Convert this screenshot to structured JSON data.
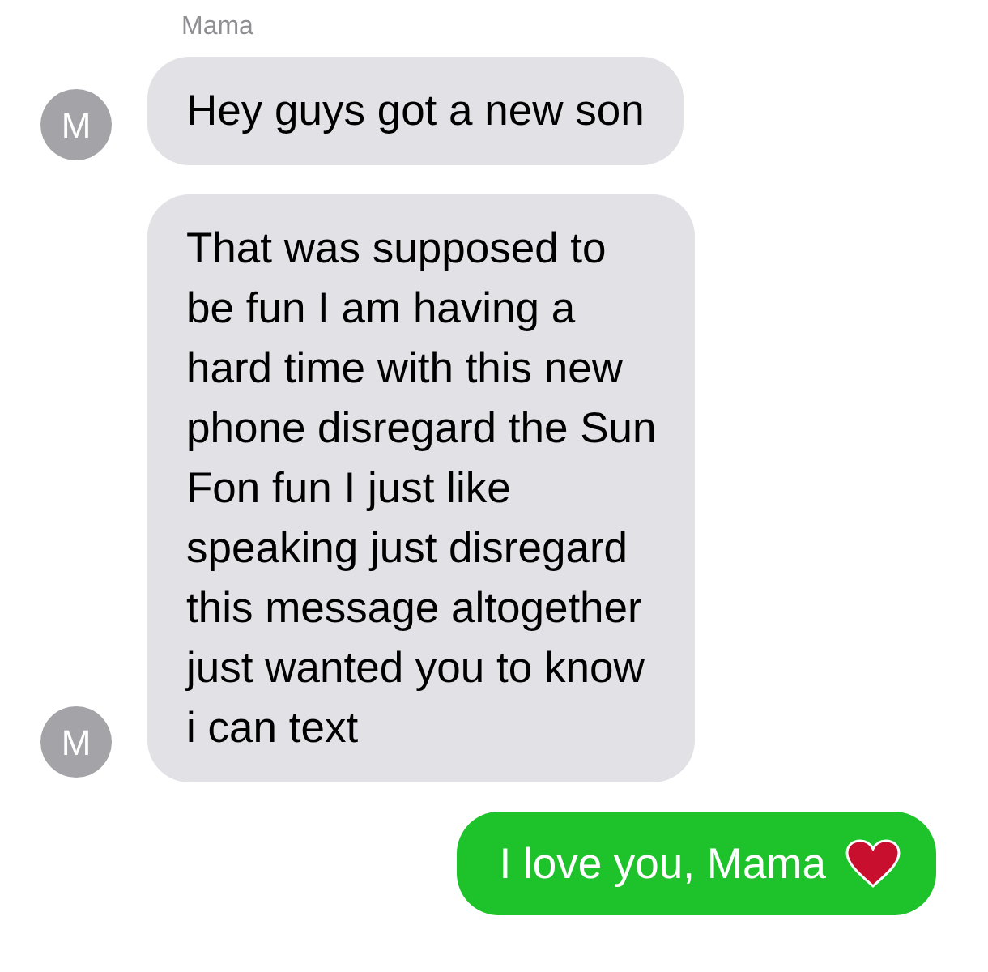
{
  "sender_name": "Mama",
  "messages": [
    {
      "kind": "received",
      "avatar": "M",
      "lines": [
        "Hey guys got a new son"
      ]
    },
    {
      "kind": "received",
      "avatar": "M",
      "lines": [
        "That was supposed to",
        "be fun I am having a",
        "hard time with this new",
        "phone disregard the Sun",
        "Fon fun I just like",
        "speaking just disregard",
        "this message altogether",
        "just wanted you to know",
        "i can text"
      ]
    },
    {
      "kind": "sent",
      "lines": [
        "I love you, Mama"
      ],
      "heart": true
    }
  ]
}
